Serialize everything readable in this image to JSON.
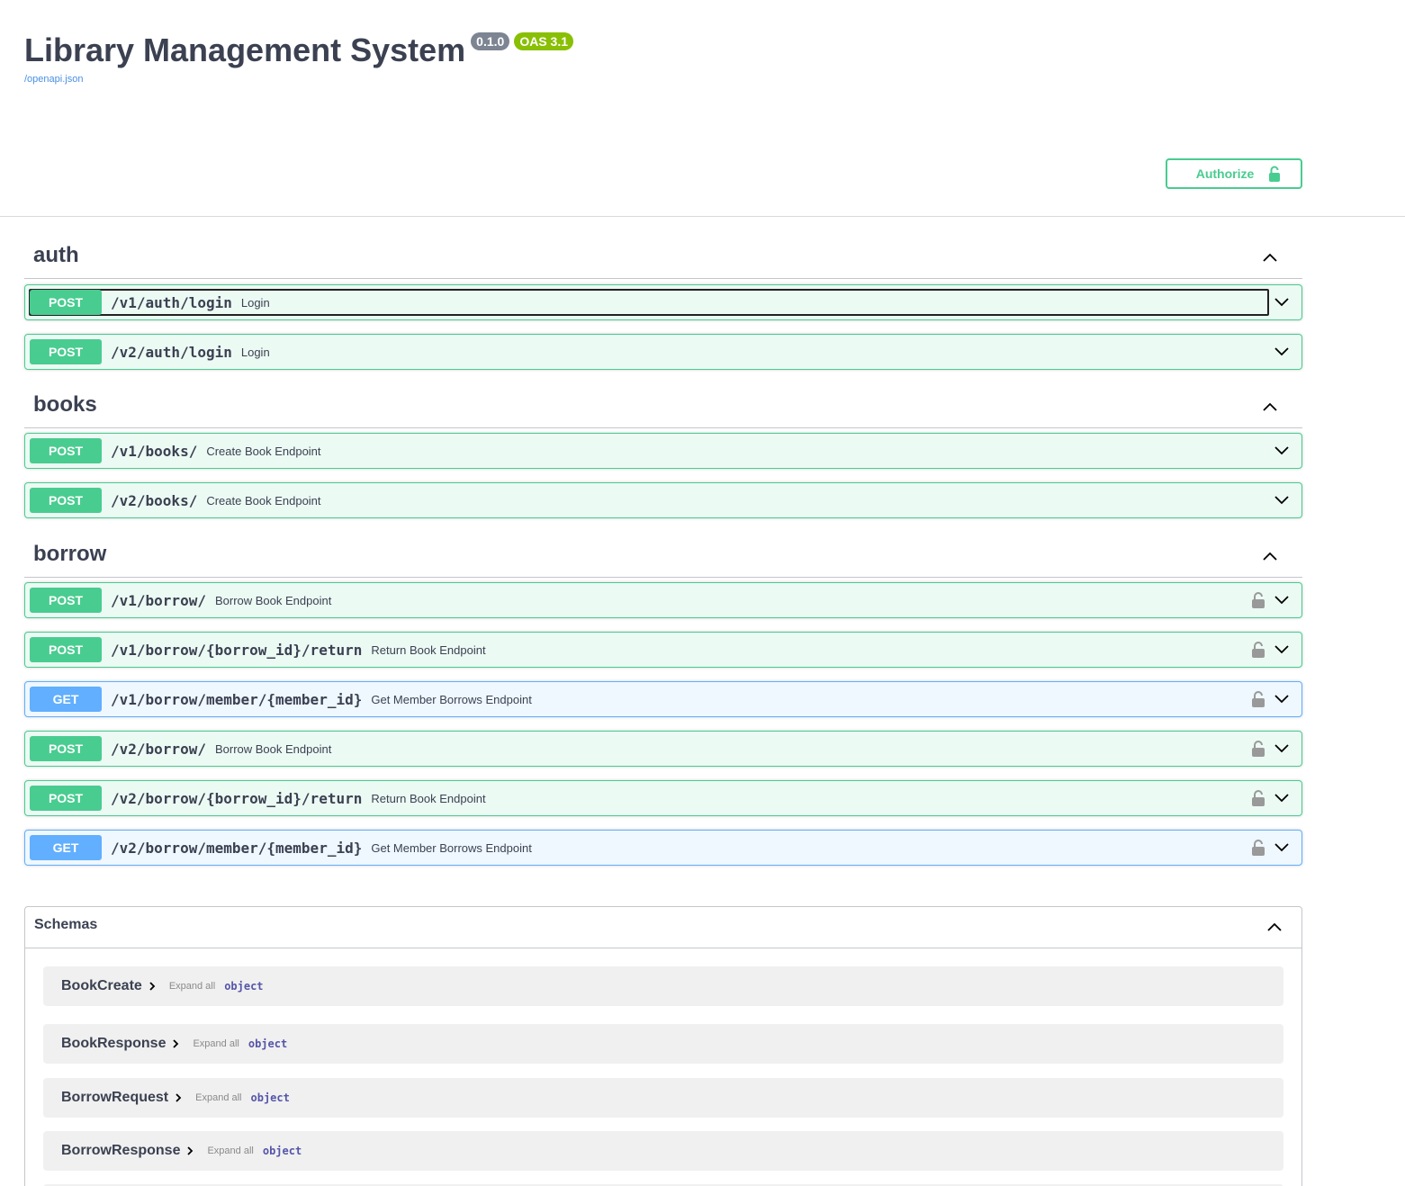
{
  "info": {
    "title": "Library Management System",
    "version": "0.1.0",
    "oas": "OAS 3.1",
    "spec_link": "/openapi.json"
  },
  "authorize": {
    "label": "Authorize",
    "icon": "unlocked-lock-icon"
  },
  "colors": {
    "post": "#49cc90",
    "get": "#61affe",
    "text": "#3b4151"
  },
  "tags": [
    {
      "name": "auth",
      "operations": [
        {
          "method": "POST",
          "path": "/v1/auth/login",
          "summary": "Login",
          "locked": false
        },
        {
          "method": "POST",
          "path": "/v2/auth/login",
          "summary": "Login",
          "locked": false
        }
      ]
    },
    {
      "name": "books",
      "operations": [
        {
          "method": "POST",
          "path": "/v1/books/",
          "summary": "Create Book Endpoint",
          "locked": false
        },
        {
          "method": "POST",
          "path": "/v2/books/",
          "summary": "Create Book Endpoint",
          "locked": false
        }
      ]
    },
    {
      "name": "borrow",
      "operations": [
        {
          "method": "POST",
          "path": "/v1/borrow/",
          "summary": "Borrow Book Endpoint",
          "locked": true
        },
        {
          "method": "POST",
          "path": "/v1/borrow/{borrow_id}/return",
          "summary": "Return Book Endpoint",
          "locked": true
        },
        {
          "method": "GET",
          "path": "/v1/borrow/member/{member_id}",
          "summary": "Get Member Borrows Endpoint",
          "locked": true
        },
        {
          "method": "POST",
          "path": "/v2/borrow/",
          "summary": "Borrow Book Endpoint",
          "locked": true
        },
        {
          "method": "POST",
          "path": "/v2/borrow/{borrow_id}/return",
          "summary": "Return Book Endpoint",
          "locked": true
        },
        {
          "method": "GET",
          "path": "/v2/borrow/member/{member_id}",
          "summary": "Get Member Borrows Endpoint",
          "locked": true
        }
      ]
    }
  ],
  "schemas": {
    "title": "Schemas",
    "models": [
      {
        "name": "BookCreate",
        "expand": "Expand all",
        "type": "object"
      },
      {
        "name": "BookResponse",
        "expand": "Expand all",
        "type": "object"
      },
      {
        "name": "BorrowRequest",
        "expand": "Expand all",
        "type": "object"
      },
      {
        "name": "BorrowResponse",
        "expand": "Expand all",
        "type": "object"
      }
    ]
  }
}
